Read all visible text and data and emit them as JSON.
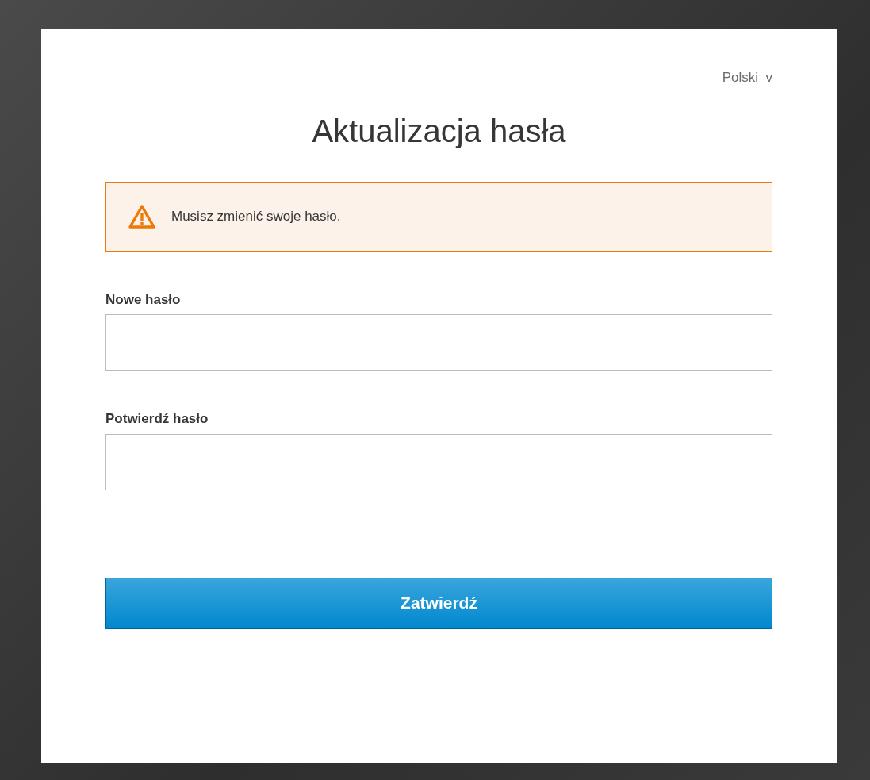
{
  "locale": {
    "label": "Polski",
    "caret": "v"
  },
  "title": "Aktualizacja hasła",
  "alert": {
    "kind": "warning",
    "message": "Musisz zmienić swoje hasło."
  },
  "fields": [
    {
      "label": "Nowe hasło"
    },
    {
      "label": "Potwierdź hasło"
    }
  ],
  "submit": "Zatwierdź"
}
